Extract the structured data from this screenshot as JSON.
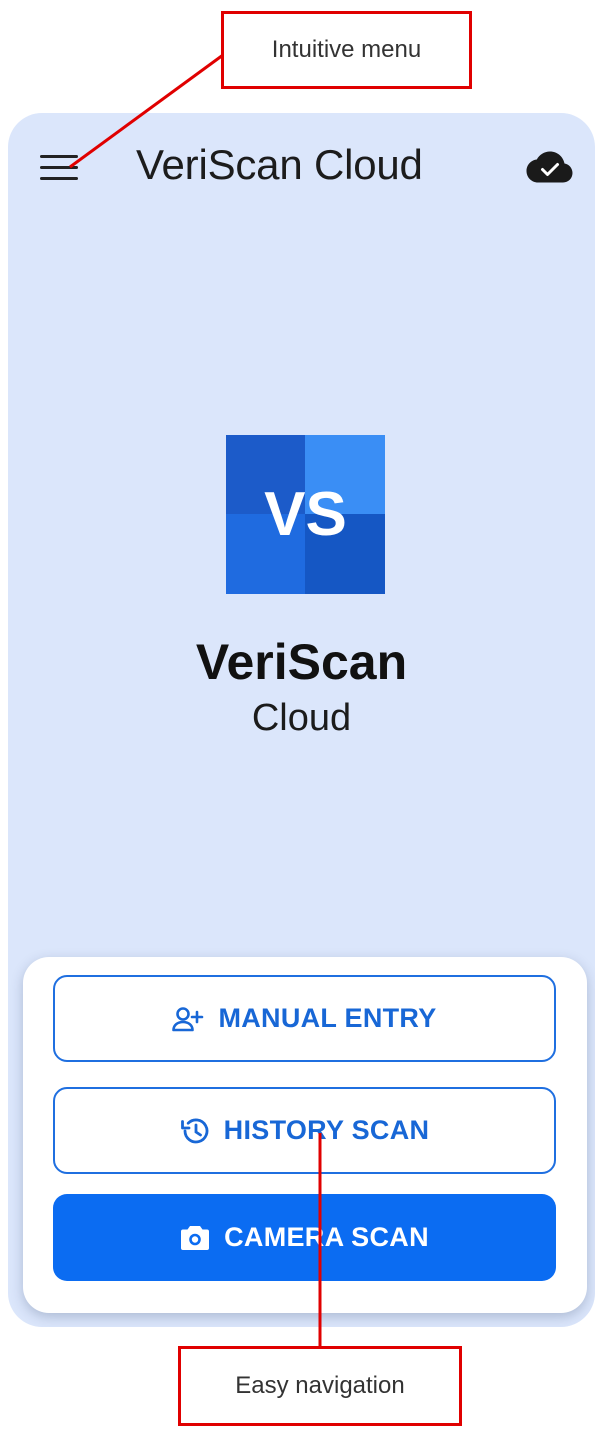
{
  "annotations": {
    "top_callout": "Intuitive menu",
    "bottom_callout": "Easy navigation",
    "color": "#e00000"
  },
  "appbar": {
    "title": "VeriScan Cloud",
    "menu_icon": "hamburger-menu-icon",
    "status_icon": "cloud-done-icon"
  },
  "brand": {
    "logo_text": "VS",
    "name": "VeriScan",
    "subtitle": "Cloud"
  },
  "actions": {
    "manual_entry": {
      "label": "MANUAL ENTRY",
      "icon": "person-add-icon"
    },
    "history_scan": {
      "label": "HISTORY SCAN",
      "icon": "history-icon"
    },
    "camera_scan": {
      "label": "CAMERA SCAN",
      "icon": "camera-icon"
    }
  },
  "colors": {
    "background": "#dbe6fb",
    "accent": "#0b6cf2",
    "outline_text": "#1867d6"
  }
}
